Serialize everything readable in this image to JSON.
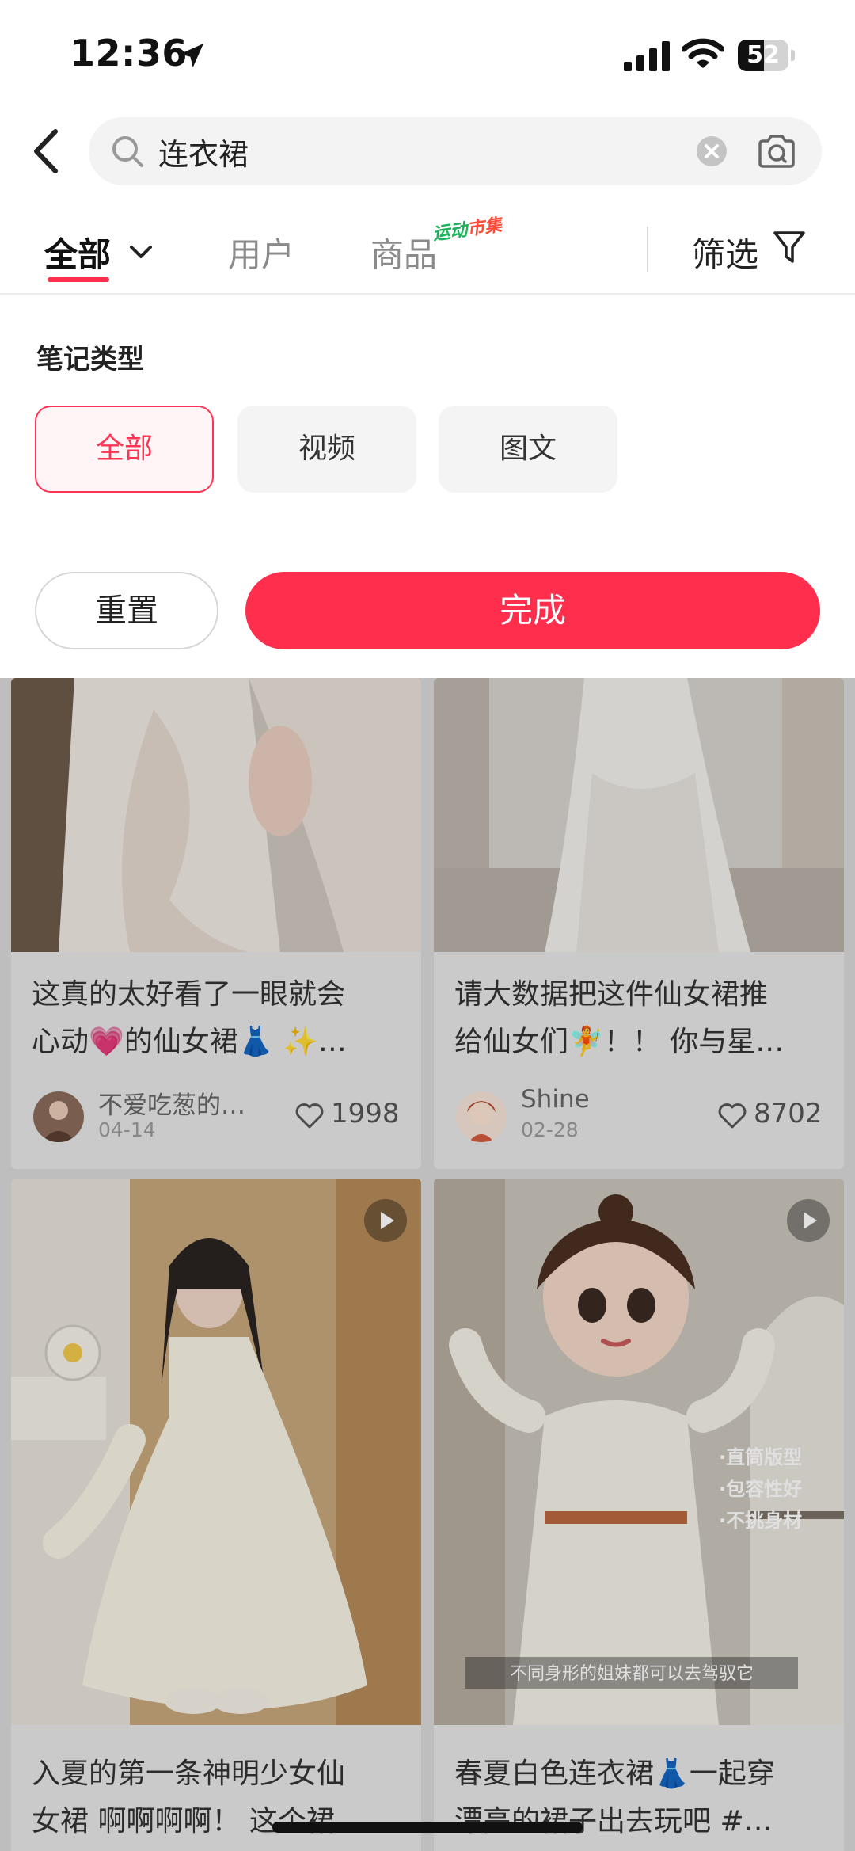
{
  "status_bar": {
    "time": "12:36",
    "battery_level": "52",
    "battery_fraction": 0.52
  },
  "search": {
    "query": "连衣裙",
    "placeholder": ""
  },
  "tabs": {
    "all": "全部",
    "users": "用户",
    "goods": "商品",
    "promo_tag": [
      "运动",
      "市集"
    ],
    "filter": "筛选"
  },
  "filter_panel": {
    "section_title": "笔记类型",
    "options": [
      "全部",
      "视频",
      "图文"
    ],
    "selected_option": "全部",
    "reset_label": "重置",
    "done_label": "完成"
  },
  "feed": {
    "cards": [
      {
        "title_line1": "这真的太好看了一眼就会",
        "title_line2": "心动💗的仙女裙👗 ✨…",
        "author": "不爱吃葱的…",
        "date": "04-14",
        "likes": "1998"
      },
      {
        "title_line1": "请大数据把这件仙女裙推",
        "title_line2": "给仙女们🧚！！ 你与星…",
        "author": "Shine",
        "date": "02-28",
        "likes": "8702"
      },
      {
        "title_line1": "入夏的第一条神明少女仙",
        "title_line2": "女裙 啊啊啊啊！ 这个裙…",
        "is_video": true
      },
      {
        "title_line1": "春夏白色连衣裙👗一起穿",
        "title_line2": "漂亮的裙子出去玩吧 #…",
        "is_video": true,
        "overlay_tags": [
          "·直筒版型",
          "·包容性好",
          "·不挑身材"
        ],
        "caption": "不同身形的姐妹都可以去驾驭它"
      }
    ]
  },
  "colors": {
    "accent": "#ff2e4d",
    "chip_selected_bg": "#fff5f6"
  },
  "icons": [
    "location-arrow-icon",
    "signal-icon",
    "wifi-icon",
    "back-icon",
    "search-icon",
    "clear-icon",
    "camera-icon",
    "chevron-down-icon",
    "filter-funnel-icon",
    "heart-icon",
    "play-icon"
  ]
}
